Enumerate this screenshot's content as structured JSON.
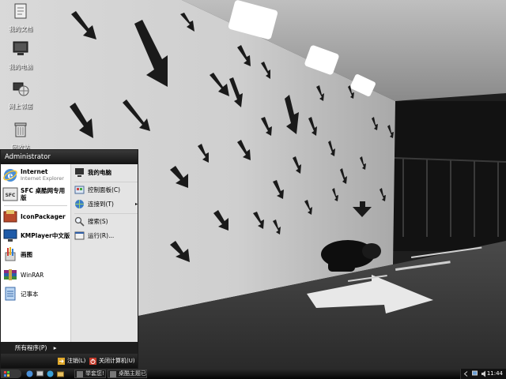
{
  "desktop": {
    "icons": [
      {
        "label": "我的文档",
        "icon": "my-documents-icon"
      },
      {
        "label": "我的电脑",
        "icon": "my-computer-icon"
      },
      {
        "label": "网上邻居",
        "icon": "network-places-icon"
      },
      {
        "label": "回收站",
        "icon": "recycle-bin-icon"
      }
    ]
  },
  "start_menu": {
    "user": "Administrator",
    "pinned": [
      {
        "title": "Internet",
        "subtitle": "Internet Explorer",
        "icon": "internet-explorer-icon"
      },
      {
        "title": "SFC 桌酷网专用版",
        "icon": "sfc-icon"
      }
    ],
    "recent": [
      {
        "title": "IconPackager",
        "icon": "iconpackager-icon"
      },
      {
        "title": "KMPlayer中文版",
        "icon": "kmplayer-icon"
      },
      {
        "title": "画图",
        "icon": "paint-icon"
      },
      {
        "title": "WinRAR",
        "icon": "winrar-icon"
      },
      {
        "title": "记事本",
        "icon": "notepad-icon"
      }
    ],
    "all_programs": "所有程序(P)",
    "all_programs_arrow": "▸",
    "right": [
      {
        "label": "我的电脑",
        "icon": "my-computer-icon"
      },
      {
        "label": "控制面板(C)",
        "icon": "control-panel-icon"
      },
      {
        "label": "连接到(T)",
        "icon": "connect-to-icon",
        "arrow": "▸"
      },
      {
        "label": "搜索(S)",
        "icon": "search-icon"
      },
      {
        "label": "运行(R)...",
        "icon": "run-icon"
      }
    ],
    "footer": {
      "logoff": "注销(L)",
      "shutdown": "关闭计算机(U)"
    }
  },
  "taskbar": {
    "tasks": [
      {
        "label": "举套您!"
      },
      {
        "label": "桌酷主题已..."
      }
    ],
    "clock": "11:44"
  },
  "colors": {
    "start_menu_header": "#1a1a1a",
    "taskbar": "#0a0a0a",
    "accent": "#000000"
  }
}
